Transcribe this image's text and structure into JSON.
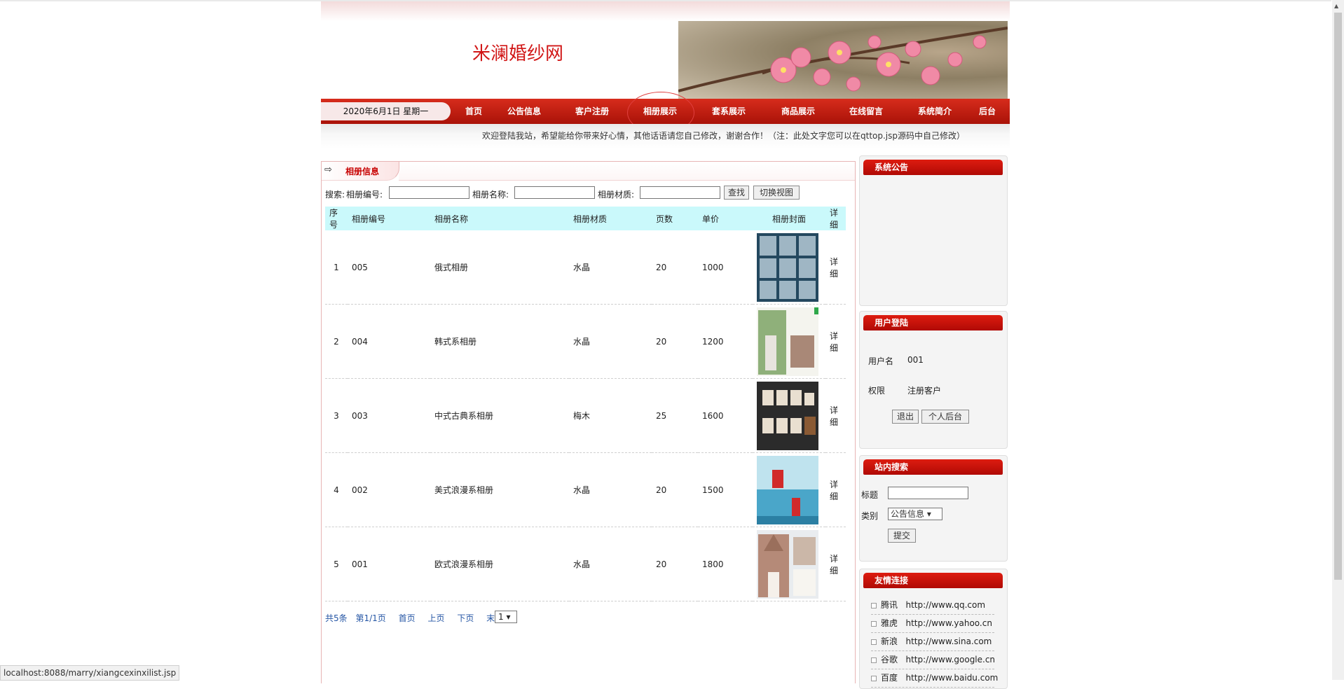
{
  "site": {
    "title": "米澜婚纱网",
    "date": "2020年6月1日 星期一",
    "marquee": "欢迎登陆我站，希望能给你带来好心情，其他话语请您自己修改，谢谢合作！（注：此处文字您可以在qttop.jsp源码中自己修改）"
  },
  "nav": {
    "items": [
      "首页",
      "公告信息",
      "客户注册",
      "相册展示",
      "套系展示",
      "商品展示",
      "在线留言",
      "系统简介",
      "后台"
    ],
    "active": "相册展示"
  },
  "main": {
    "tab_title": "相册信息",
    "search": {
      "prefix": "搜索:",
      "label_no": "相册编号:",
      "label_name": "相册名称:",
      "label_material": "相册材质:",
      "btn_search": "查找",
      "btn_switch": "切换视图"
    },
    "columns": [
      "序号",
      "相册编号",
      "相册名称",
      "相册材质",
      "页数",
      "单价",
      "相册封面",
      "详细"
    ],
    "rows": [
      {
        "idx": "1",
        "no": "005",
        "name": "俄式相册",
        "material": "水晶",
        "pages": "20",
        "price": "1000",
        "detail": "详细"
      },
      {
        "idx": "2",
        "no": "004",
        "name": "韩式系相册",
        "material": "水晶",
        "pages": "20",
        "price": "1200",
        "detail": "详细"
      },
      {
        "idx": "3",
        "no": "003",
        "name": "中式古典系相册",
        "material": "梅木",
        "pages": "25",
        "price": "1600",
        "detail": "详细"
      },
      {
        "idx": "4",
        "no": "002",
        "name": "美式浪漫系相册",
        "material": "水晶",
        "pages": "20",
        "price": "1500",
        "detail": "详细"
      },
      {
        "idx": "5",
        "no": "001",
        "name": "欧式浪漫系相册",
        "material": "水晶",
        "pages": "20",
        "price": "1800",
        "detail": "详细"
      }
    ],
    "pager": {
      "total": "共5条",
      "page": "第1/1页",
      "first": "首页",
      "prev": "上页",
      "next": "下页",
      "last": "末页",
      "select": "1 ▾"
    }
  },
  "sidebar": {
    "notice_title": "系统公告",
    "login": {
      "title": "用户登陆",
      "user_label": "用户名",
      "user_value": "001",
      "role_label": "权限",
      "role_value": "注册客户",
      "logout": "退出",
      "personal": "个人后台"
    },
    "search": {
      "title": "站内搜索",
      "title_label": "标题",
      "type_label": "类别",
      "type_value": "公告信息 ▾",
      "submit": "提交"
    },
    "links": {
      "title": "友情连接",
      "items": [
        {
          "name": "腾讯",
          "url": "http://www.qq.com"
        },
        {
          "name": "雅虎",
          "url": "http://www.yahoo.cn"
        },
        {
          "name": "新浪",
          "url": "http://www.sina.com"
        },
        {
          "name": "谷歌",
          "url": "http://www.google.cn"
        },
        {
          "name": "百度",
          "url": "http://www.baidu.com"
        }
      ]
    }
  },
  "statusbar": "localhost:8088/marry/xiangcexinxilist.jsp",
  "colors": {
    "nav_red": "#c21a0e",
    "title_red": "#d11616",
    "table_header": "#caf9fb",
    "link_blue": "#2455a4"
  }
}
